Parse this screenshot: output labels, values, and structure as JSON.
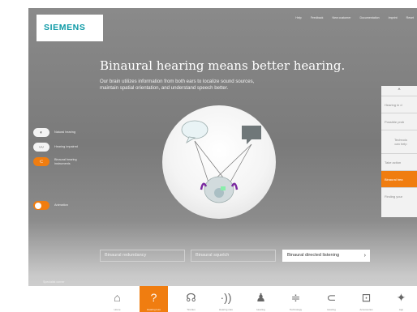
{
  "brand": {
    "logo": "SIEMENS",
    "accent": "#f07d10",
    "logo_color": "#0d9aa6"
  },
  "topnav": [
    "Help",
    "Feedback",
    "New customer",
    "Documentation",
    "Imprint",
    "Reset"
  ],
  "hero": {
    "title": "Binaural hearing means better hearing.",
    "subtitle_line1": "Our brain utilizes information from both ears to localize sound sources,",
    "subtitle_line2": "maintain spatial orientation, and understand speech better."
  },
  "left_toggles": [
    {
      "icon": "ear-icon",
      "label": "Natural hearing",
      "state": "on"
    },
    {
      "icon": "ear-impaired-icon",
      "label": "Hearing impaired",
      "state": "on"
    },
    {
      "icon": "hearing-aid-icon",
      "label_line1": "Binaural hearing",
      "label_line2": "instruments",
      "state": "active"
    },
    {
      "icon": "toggle-icon",
      "label": "Animation",
      "state": "active"
    }
  ],
  "feature_buttons": [
    {
      "label": "Binaural redundancy",
      "active": false
    },
    {
      "label": "Binaural squelch",
      "active": false
    },
    {
      "label": "Binaural directed listening",
      "active": true
    }
  ],
  "right_panel": {
    "up_label": "^",
    "items": [
      {
        "label": "Hearing in d",
        "active": false
      },
      {
        "label": "Possible prob",
        "active": false
      },
      {
        "label_line1": "Technolo",
        "label_line2": "can help",
        "active": false
      },
      {
        "label": "Take action",
        "active": false
      },
      {
        "label": "Binaural hea",
        "active": true
      },
      {
        "label": "Finding your",
        "active": false
      }
    ]
  },
  "specialist_label": "Specialist corner",
  "bottom_tabs": [
    {
      "icon": "home-icon",
      "glyph": "⌂",
      "label": "Home",
      "active": false
    },
    {
      "icon": "question-ear-icon",
      "glyph": "?",
      "label": "Hearing loss",
      "active": true
    },
    {
      "icon": "brain-icon",
      "glyph": "☊",
      "label": "Tinnitus",
      "active": false
    },
    {
      "icon": "sound-waves-icon",
      "glyph": "·))",
      "label": "Hearing care",
      "active": false
    },
    {
      "icon": "person-sound-icon",
      "glyph": "♟",
      "label": "Hearing",
      "active": false
    },
    {
      "icon": "equalizer-icon",
      "glyph": "≑",
      "label": "Technology",
      "active": false
    },
    {
      "icon": "hearing-aid-icon",
      "glyph": "⊂",
      "label": "Hearing",
      "active": false
    },
    {
      "icon": "accessories-icon",
      "glyph": "⊡",
      "label": "Accessories",
      "active": false
    },
    {
      "icon": "app-icon",
      "glyph": "✦",
      "label": "App",
      "active": false
    }
  ]
}
